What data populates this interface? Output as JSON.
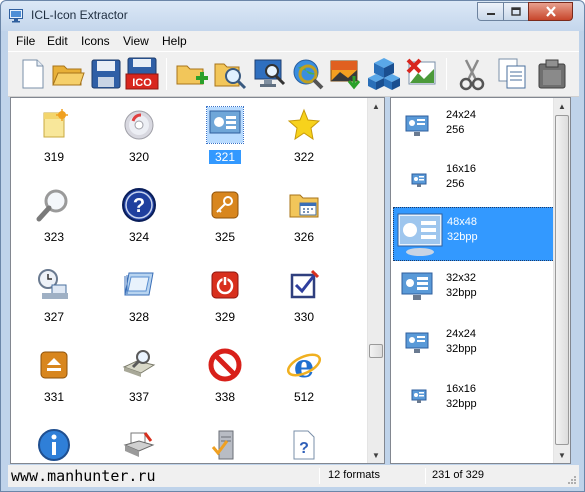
{
  "window": {
    "title": "ICL-Icon Extractor"
  },
  "menu": [
    "File",
    "Edit",
    "Icons",
    "View",
    "Help"
  ],
  "toolbar": {
    "buttons": [
      "new-icon",
      "open-folder-icon",
      "save-icon",
      "save-ico-icon",
      "add-folder-icon",
      "search-folder-icon",
      "monitor-search-icon",
      "globe-search-icon",
      "export-image-icon",
      "cubes-icon",
      "delete-image-icon",
      "cut-icon",
      "copy-icon",
      "paste-icon"
    ],
    "save_ico_label": "ICO"
  },
  "icons": [
    {
      "label": "319",
      "icon": "sticky-note-icon"
    },
    {
      "label": "320",
      "icon": "cd-disc-icon"
    },
    {
      "label": "321",
      "icon": "monitor-settings-icon",
      "selected": true
    },
    {
      "label": "322",
      "icon": "star-icon"
    },
    {
      "label": "323",
      "icon": "magnifier-icon"
    },
    {
      "label": "324",
      "icon": "help-question-icon"
    },
    {
      "label": "325",
      "icon": "key-icon"
    },
    {
      "label": "326",
      "icon": "calendar-folder-icon"
    },
    {
      "label": "327",
      "icon": "clock-network-icon"
    },
    {
      "label": "328",
      "icon": "window-stack-icon"
    },
    {
      "label": "329",
      "icon": "power-icon"
    },
    {
      "label": "330",
      "icon": "checkbox-icon"
    },
    {
      "label": "331",
      "icon": "eject-icon"
    },
    {
      "label": "337",
      "icon": "search-printer-icon"
    },
    {
      "label": "338",
      "icon": "no-entry-icon"
    },
    {
      "label": "512",
      "icon": "internet-explorer-icon"
    },
    {
      "label": "",
      "icon": "info-icon"
    },
    {
      "label": "",
      "icon": "printer-icon"
    },
    {
      "label": "",
      "icon": "server-check-icon"
    },
    {
      "label": "",
      "icon": "help-document-icon"
    }
  ],
  "formats": [
    {
      "size": "24x24",
      "depth": "256"
    },
    {
      "size": "16x16",
      "depth": "256"
    },
    {
      "size": "48x48",
      "depth": "32bpp",
      "selected": true
    },
    {
      "size": "32x32",
      "depth": "32bpp"
    },
    {
      "size": "24x24",
      "depth": "32bpp"
    },
    {
      "size": "16x16",
      "depth": "32bpp"
    }
  ],
  "status": {
    "site": "www.manhunter.ru",
    "formats": "12 formats",
    "position": "231 of 329"
  },
  "colors": {
    "selection": "#3399ff",
    "title_bg": "#c4d6ec",
    "close_button": "#c7462b"
  }
}
